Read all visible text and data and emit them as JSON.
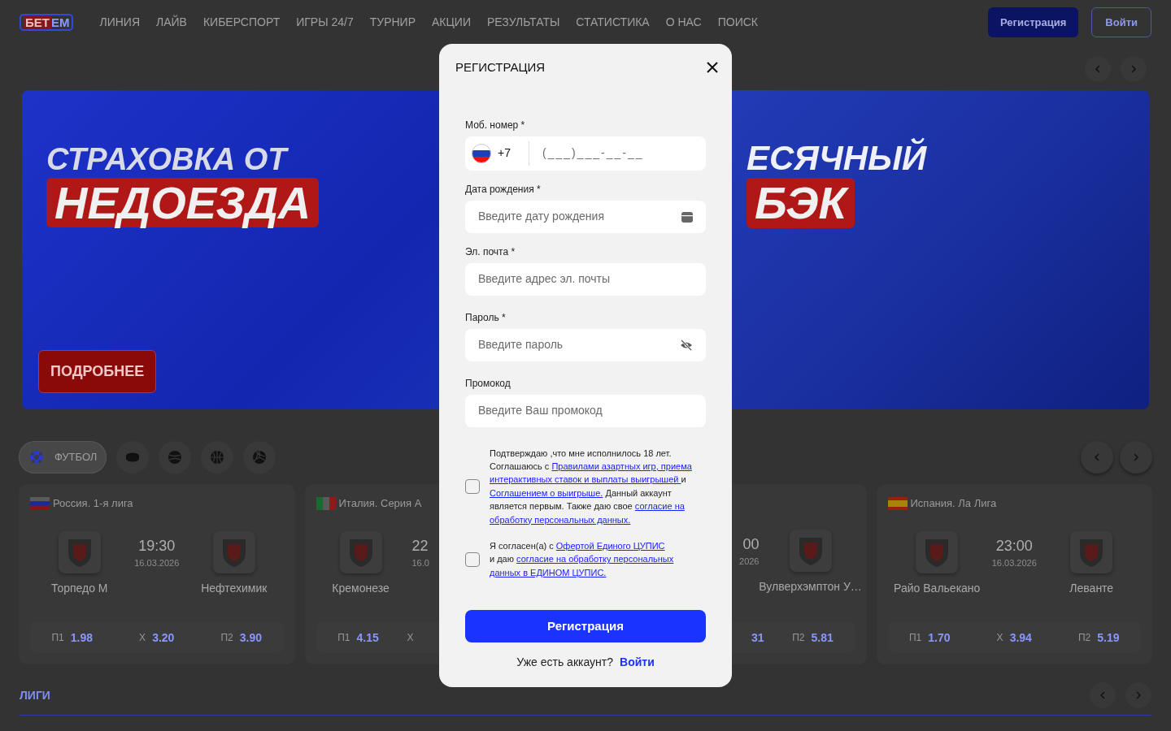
{
  "header": {
    "logo_left": "БЕТ",
    "logo_right": "ЕМ",
    "nav": [
      "ЛИНИЯ",
      "ЛАЙВ",
      "КИБЕРСПОРТ",
      "ИГРЫ 24/7",
      "ТУРНИР",
      "АКЦИИ",
      "РЕЗУЛЬТАТЫ",
      "СТАТИСТИКА",
      "О НАС",
      "ПОИСК"
    ],
    "register_button": "Регистрация",
    "login_button": "Войти"
  },
  "banners": [
    {
      "kind": "hockey",
      "top_line": "СТРАХОВКА ОТ",
      "bottom_line": "НЕДОЕЗДА",
      "button": "ПОДРОБНЕЕ"
    },
    {
      "kind": "sports",
      "top_line": "ЕСЯЧНЫЙ",
      "bottom_line": "БЭК"
    }
  ],
  "sports": [
    {
      "kind": "football",
      "label": "ФУТБОЛ",
      "selected": true
    },
    {
      "kind": "hockey",
      "selected": false
    },
    {
      "kind": "tennis",
      "selected": false
    },
    {
      "kind": "basketball",
      "selected": false
    },
    {
      "kind": "volleyball",
      "selected": false
    }
  ],
  "matches": [
    {
      "kind": "full",
      "league": {
        "kind": "russia",
        "name": "Россия. 1-я лига"
      },
      "home": "Торпедо М",
      "away": "Нефтехимик",
      "time": "19:30",
      "date": "16.03.2026",
      "odds": [
        {
          "label": "П1",
          "value": "1.98"
        },
        {
          "label": "Х",
          "value": "3.20"
        },
        {
          "label": "П2",
          "value": "3.90"
        }
      ]
    },
    {
      "kind": "cut_right",
      "league": {
        "kind": "italy",
        "name": "Италия. Серия А"
      },
      "home": "Кремонезе",
      "time": "22",
      "date": "16.0",
      "odds": [
        {
          "label": "П1",
          "value": "4.15"
        },
        {
          "label": "Х"
        }
      ]
    },
    {
      "kind": "cut_left",
      "away": "Вулверхэмптон У…",
      "time": "00",
      "date": "2026",
      "odds": [
        {
          "value": "31"
        },
        {
          "label": "П2",
          "value": "5.81"
        }
      ]
    },
    {
      "kind": "full",
      "league": {
        "kind": "spain",
        "name": "Испания. Ла Лига"
      },
      "home": "Райо Вальекано",
      "away": "Леванте",
      "time": "23:00",
      "date": "16.03.2026",
      "odds": [
        {
          "label": "П1",
          "value": "1.70"
        },
        {
          "label": "Х",
          "value": "3.94"
        },
        {
          "label": "П2",
          "value": "5.19"
        }
      ]
    }
  ],
  "leagues": {
    "title": "ЛИГИ"
  },
  "modal": {
    "title": "РЕГИСТРАЦИЯ",
    "fields": [
      {
        "kind": "phone",
        "label": "Моб. номер *",
        "prefix": "+7",
        "placeholder": "(___)___-__-__"
      },
      {
        "kind": "date",
        "label": "Дата рождения *",
        "placeholder": "Введите дату рождения"
      },
      {
        "kind": "email",
        "label": "Эл. почта *",
        "placeholder": "Введите адрес эл. почты"
      },
      {
        "kind": "password",
        "label": "Пароль *",
        "placeholder": "Введите пароль"
      },
      {
        "kind": "text",
        "label": "Промокод",
        "placeholder": "Введите Ваш промокод"
      }
    ],
    "consents": [
      {
        "checked": false,
        "lines": [
          [
            {
              "kind": "text",
              "text": "Подтверждаю ,что мне исполнилось 18 лет."
            }
          ],
          [
            {
              "kind": "text",
              "text": "Соглашаюсь с "
            },
            {
              "kind": "link",
              "text": "Правилами азартных игр, приема"
            }
          ],
          [
            {
              "kind": "link",
              "text": "интерактивных ставок и выплаты выигрышей "
            },
            {
              "kind": "text",
              "text": "и"
            }
          ],
          [
            {
              "kind": "link",
              "text": "Соглашением о выигрыше."
            },
            {
              "kind": "text",
              "text": " Данный аккаунт"
            }
          ],
          [
            {
              "kind": "text",
              "text": "является первым. Также даю свое "
            },
            {
              "kind": "link",
              "text": "согласие на"
            }
          ],
          [
            {
              "kind": "link",
              "text": "обработку персональных данных."
            }
          ]
        ]
      },
      {
        "checked": false,
        "lines": [
          [
            {
              "kind": "text",
              "text": "Я согласен(а) с "
            },
            {
              "kind": "link",
              "text": "Офертой Единого ЦУПИС"
            }
          ],
          [
            {
              "kind": "text",
              "text": "и даю "
            },
            {
              "kind": "link",
              "text": "согласие на обработку персональных"
            }
          ],
          [
            {
              "kind": "link",
              "text": "данных в ЕДИНОМ ЦУПИС."
            }
          ]
        ]
      }
    ],
    "submit": "Регистрация",
    "login_prompt": "Уже есть аккаунт?",
    "login_link": "Войти"
  }
}
